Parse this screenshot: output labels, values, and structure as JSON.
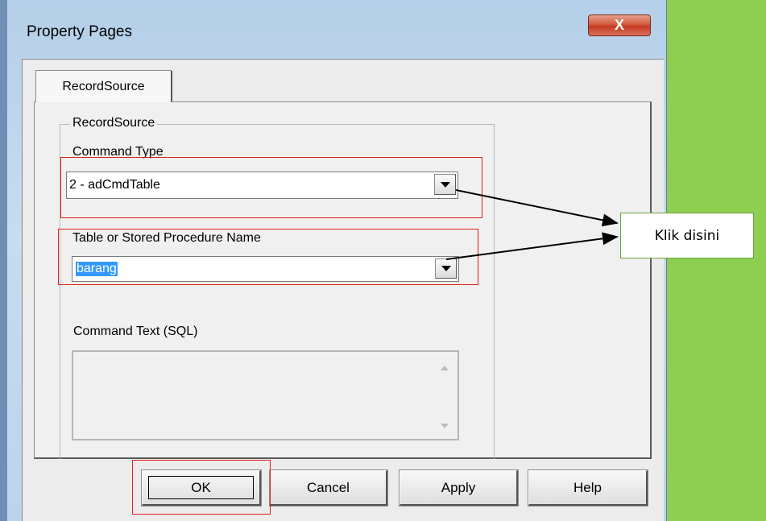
{
  "window": {
    "title": "Property Pages",
    "close_label": "X"
  },
  "tabs": [
    {
      "label": "RecordSource",
      "selected": true
    }
  ],
  "group": {
    "legend": "RecordSource"
  },
  "command_type": {
    "label": "Command Type",
    "value": "2 - adCmdTable"
  },
  "table_name": {
    "label": "Table or Stored Procedure Name",
    "value": "barang"
  },
  "command_text": {
    "label": "Command Text (SQL)",
    "value": ""
  },
  "buttons": {
    "ok": "OK",
    "cancel": "Cancel",
    "apply": "Apply",
    "help": "Help"
  },
  "annotation": {
    "text": "Klik disini",
    "highlight_color": "#e02020",
    "arrow_color": "#000000"
  },
  "colors": {
    "background": "#8ecf52",
    "selection": "#3399ff",
    "close_button": "#c43c22"
  }
}
